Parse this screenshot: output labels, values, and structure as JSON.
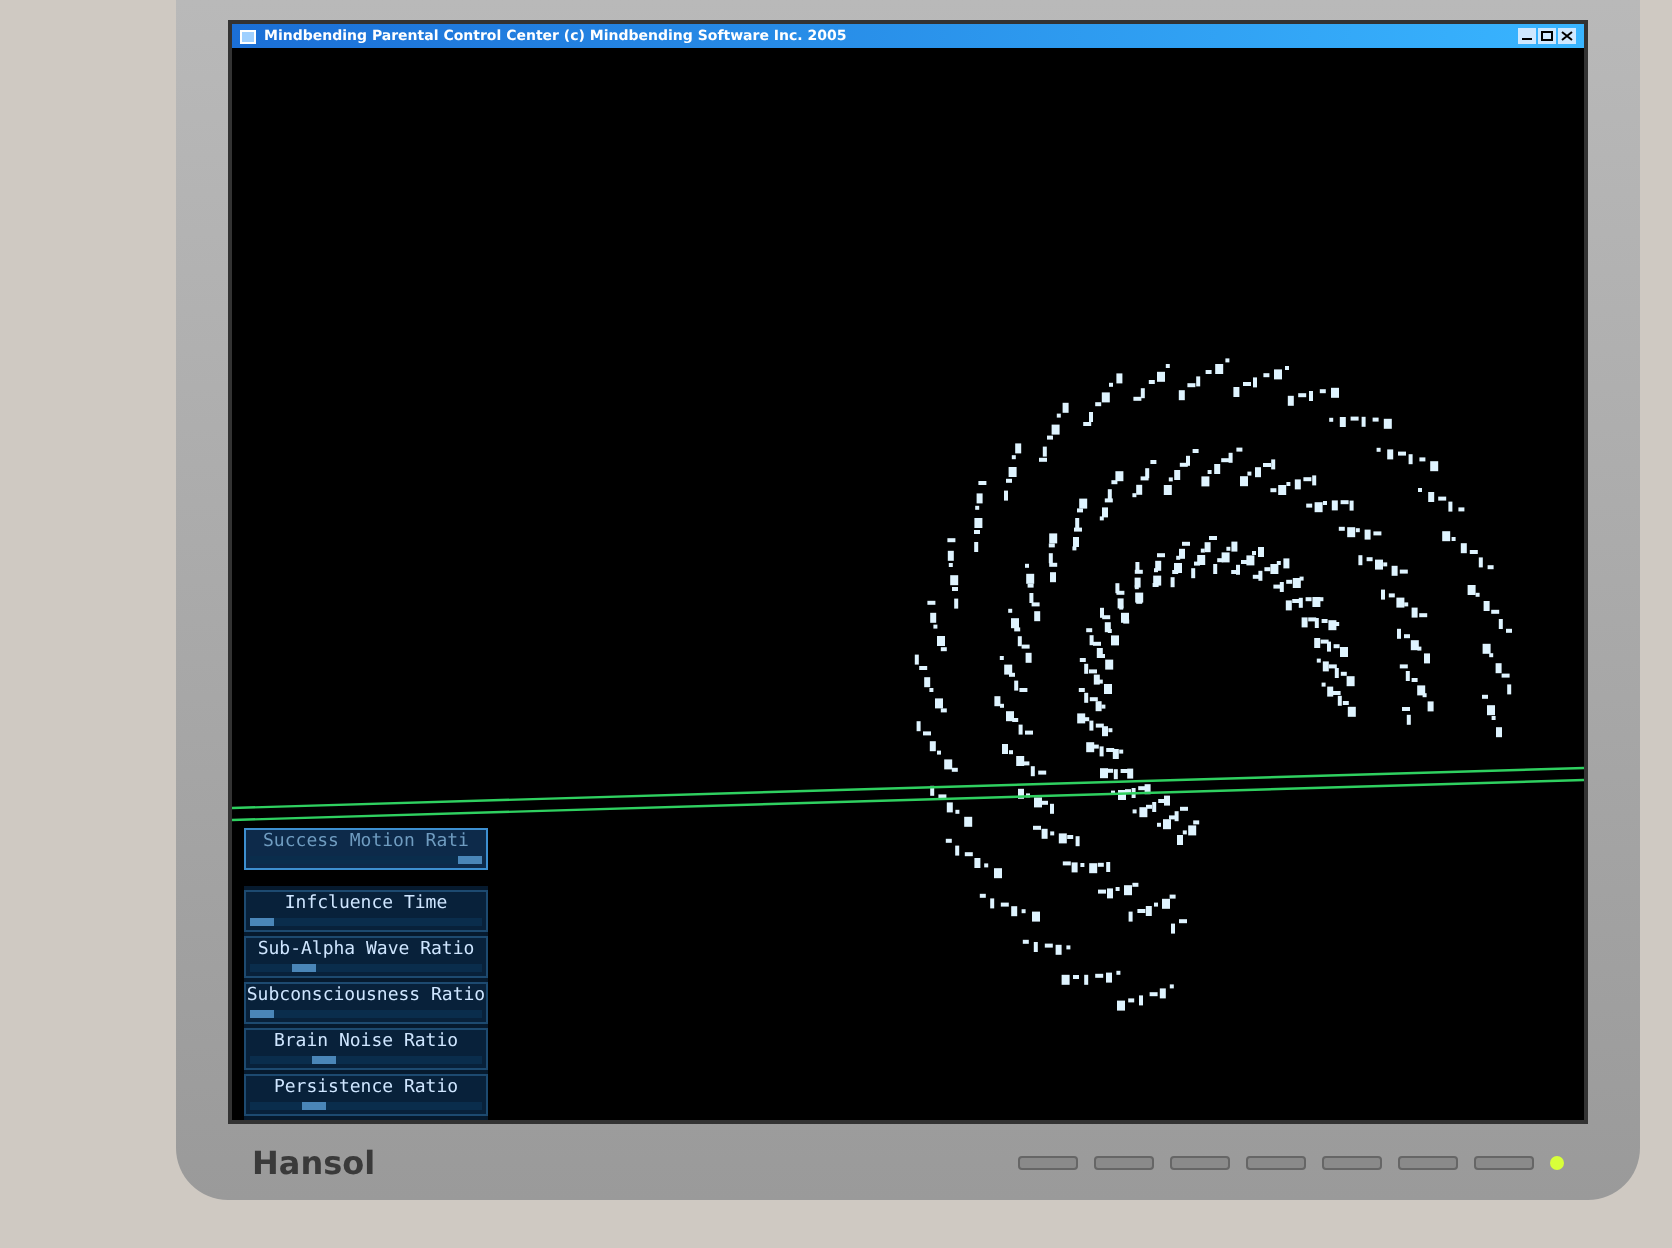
{
  "window": {
    "title": "Mindbending Parental Control Center  (c) Mindbending Software Inc. 2005"
  },
  "controls": {
    "highlighted": {
      "label": "Success Motion Rati",
      "level": 1
    },
    "sliders": [
      {
        "label": "Infcluence Time",
        "level": 0
      },
      {
        "label": "Sub-Alpha Wave Ratio",
        "level": 0.2
      },
      {
        "label": "Subconsciousness Ratio",
        "level": 0
      },
      {
        "label": "Brain Noise Ratio",
        "level": 0.3
      },
      {
        "label": "Persistence Ratio",
        "level": 0.25
      }
    ]
  },
  "monitor": {
    "brand": "Hansol",
    "power_on": true
  }
}
